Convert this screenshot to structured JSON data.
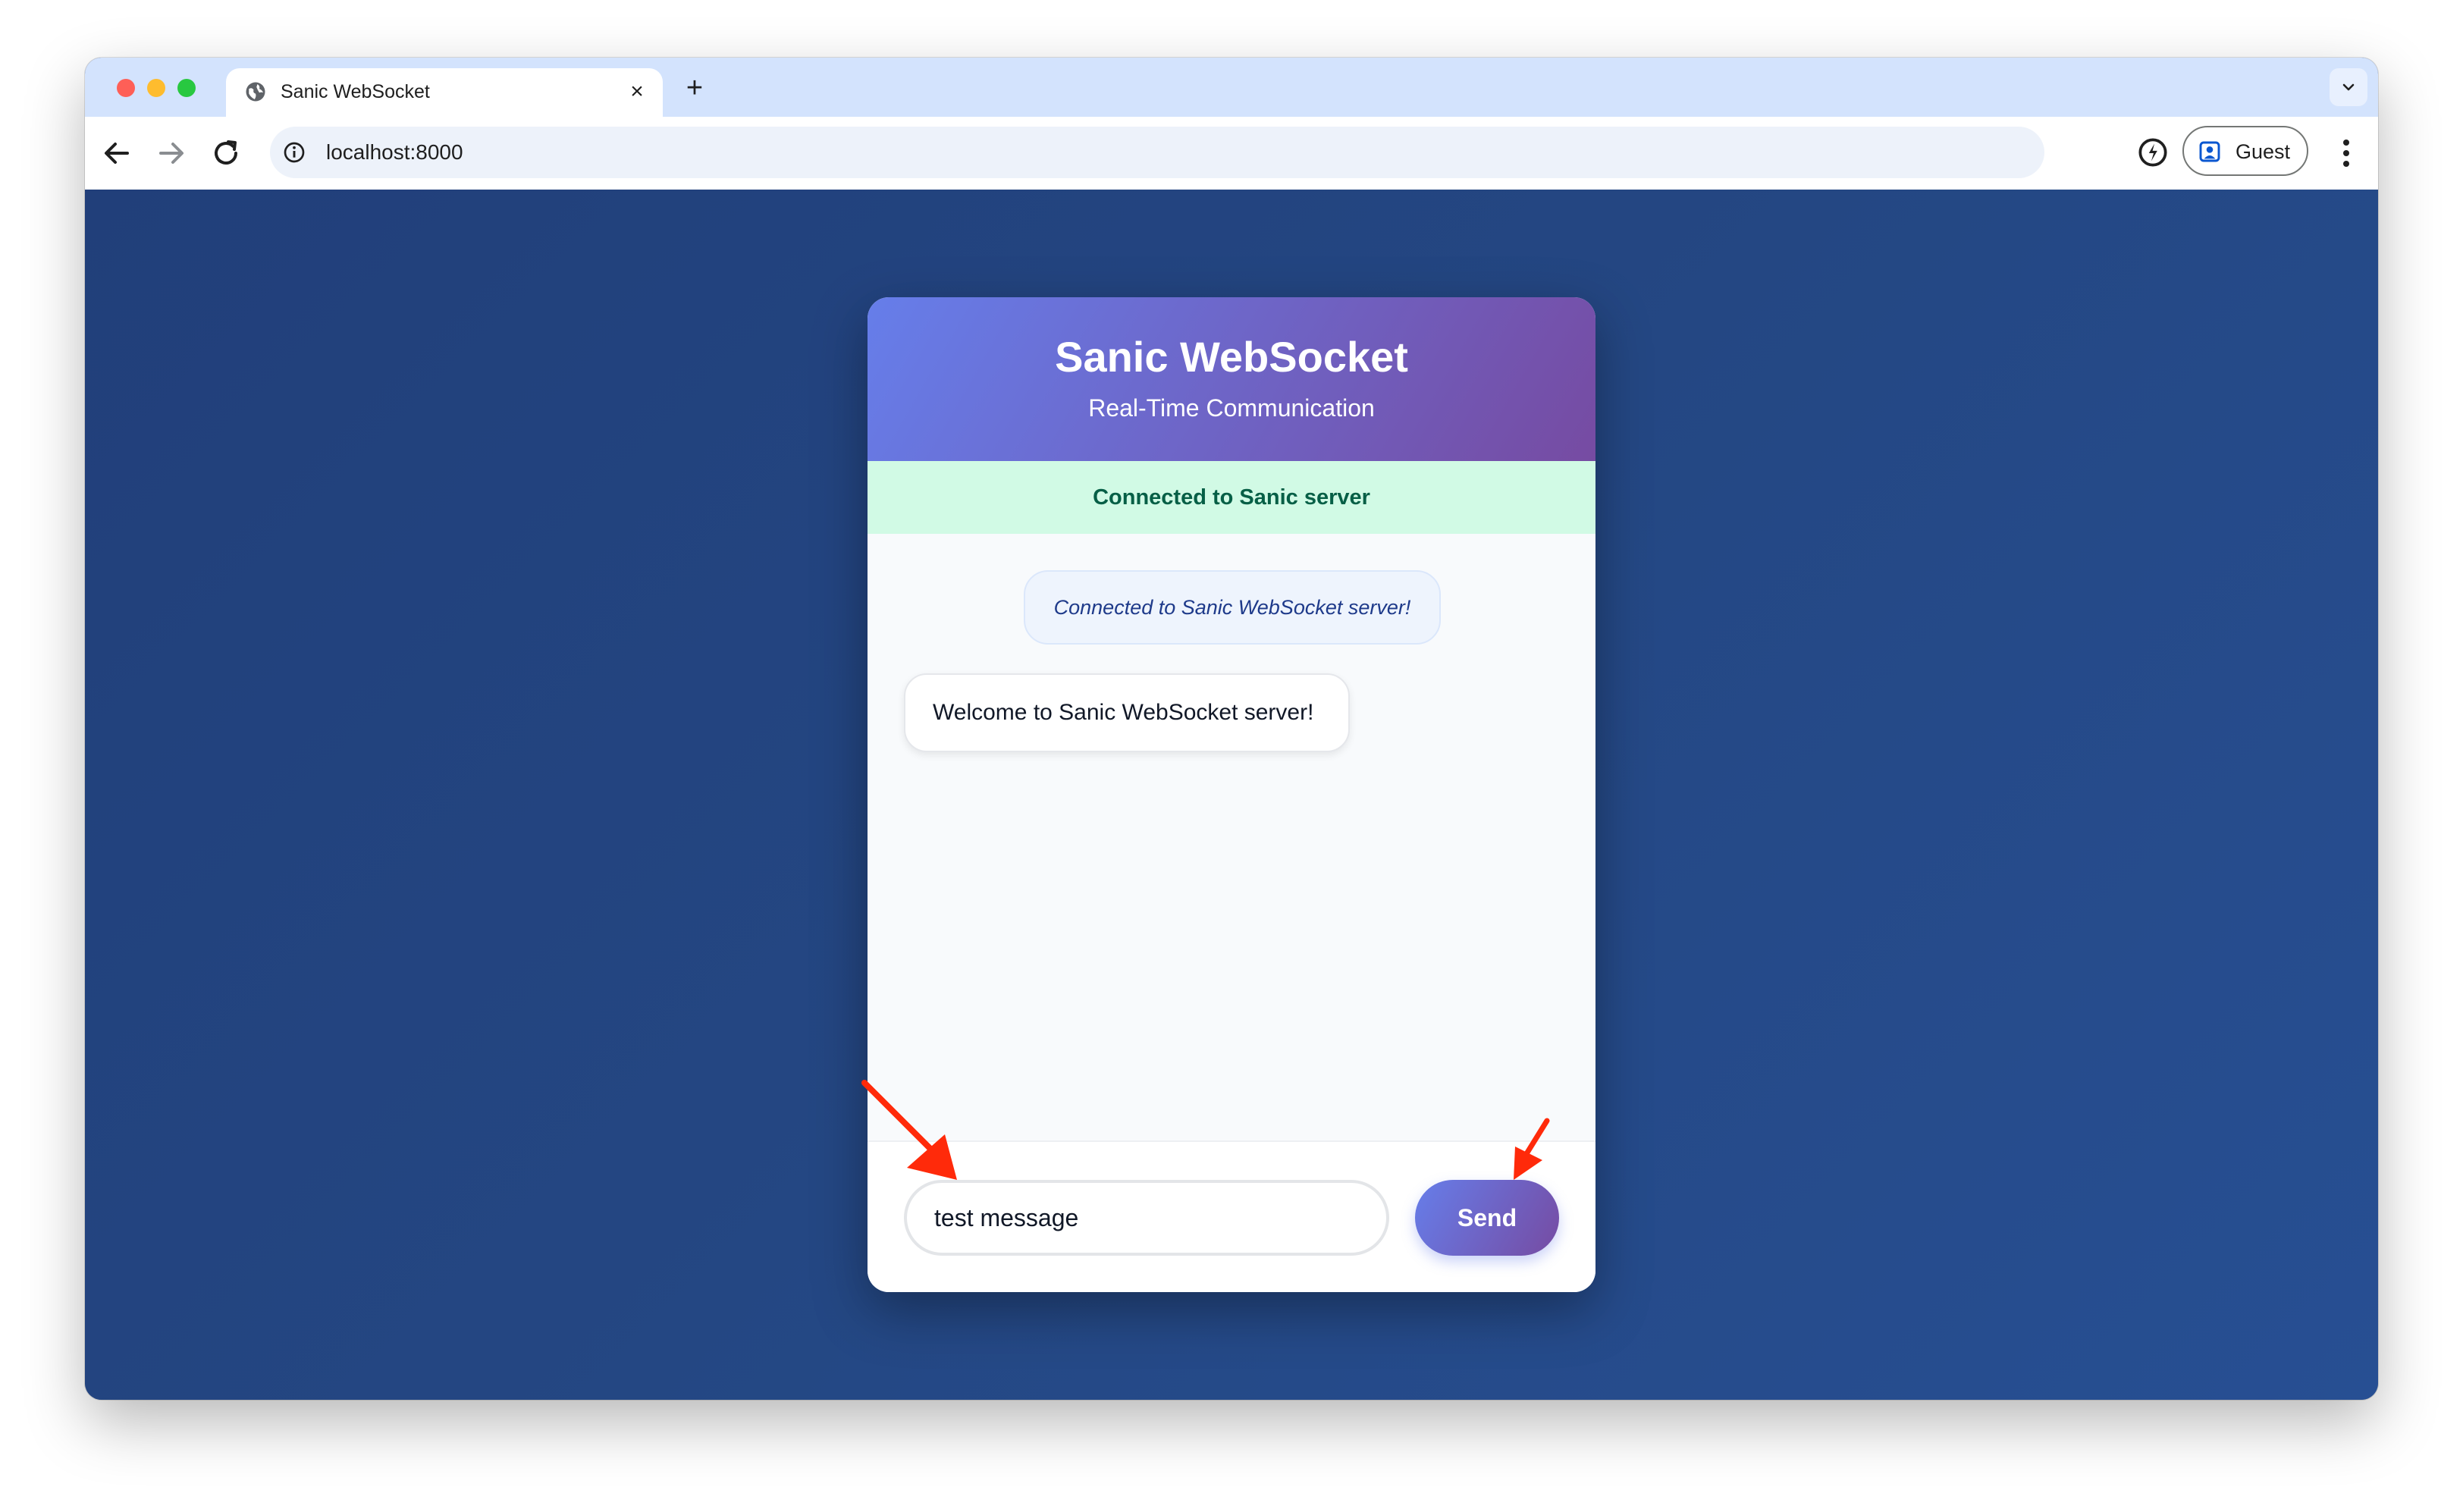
{
  "browser": {
    "tab_title": "Sanic WebSocket",
    "url": "localhost:8000",
    "profile_label": "Guest",
    "icons": {
      "tab": "globe-icon",
      "close": "close-icon",
      "new_tab": "plus-icon",
      "dropdown": "chevron-down-icon",
      "back": "back-arrow-icon",
      "forward": "forward-arrow-icon",
      "reload": "reload-icon",
      "site_info": "info-icon",
      "extension": "extension-icon",
      "profile": "profile-icon",
      "menu": "kebab-menu-icon"
    }
  },
  "app": {
    "title": "Sanic WebSocket",
    "subtitle": "Real-Time Communication",
    "status": "Connected to Sanic server",
    "messages": [
      {
        "type": "system",
        "text": "Connected to Sanic WebSocket server!"
      },
      {
        "type": "incoming",
        "text": "Welcome to Sanic WebSocket server!"
      }
    ],
    "input_value": "test message",
    "send_label": "Send"
  },
  "colors": {
    "header_gradient_start": "#667eea",
    "header_gradient_end": "#764ba2",
    "status_bg": "#d1fae5",
    "status_text": "#065f46",
    "page_bg": "#24447f",
    "annotation_arrow": "#ff2a0a"
  },
  "annotations": [
    "arrow-to-input",
    "arrow-to-send-button"
  ]
}
